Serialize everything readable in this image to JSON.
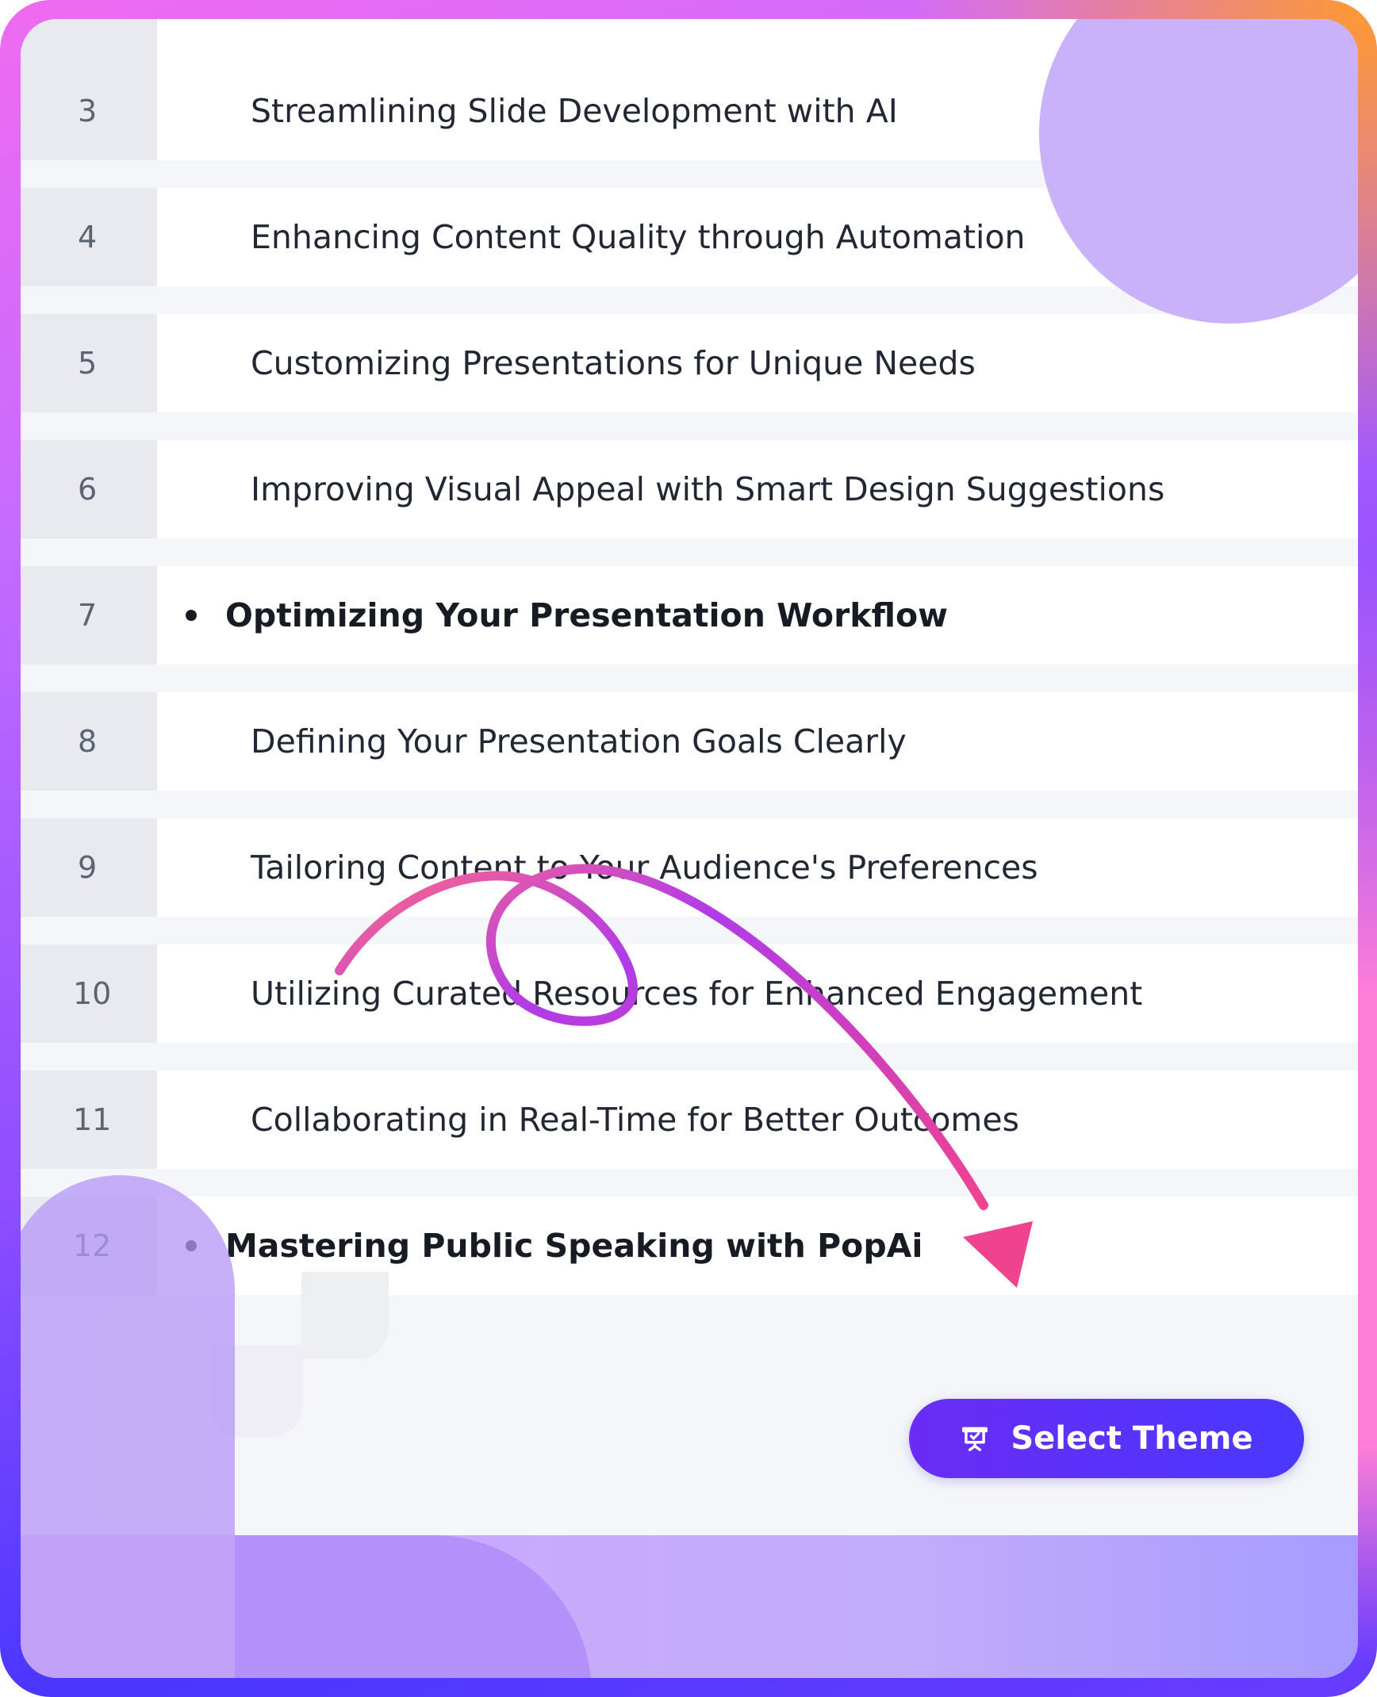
{
  "outline": {
    "rows": [
      {
        "num": "3",
        "title": "Streamlining Slide Development with AI",
        "kind": "sub"
      },
      {
        "num": "4",
        "title": "Enhancing Content Quality through Automation",
        "kind": "sub"
      },
      {
        "num": "5",
        "title": "Customizing Presentations for Unique Needs",
        "kind": "sub"
      },
      {
        "num": "6",
        "title": "Improving Visual Appeal with Smart Design Suggestions",
        "kind": "sub"
      },
      {
        "num": "7",
        "title": "Optimizing Your Presentation Workflow",
        "kind": "head"
      },
      {
        "num": "8",
        "title": "Defining Your Presentation Goals Clearly",
        "kind": "sub"
      },
      {
        "num": "9",
        "title": "Tailoring Content to Your Audience's Preferences",
        "kind": "sub"
      },
      {
        "num": "10",
        "title": "Utilizing Curated Resources for Enhanced Engagement",
        "kind": "sub"
      },
      {
        "num": "11",
        "title": "Collaborating in Real-Time for Better Outcomes",
        "kind": "sub"
      },
      {
        "num": "12",
        "title": "Mastering Public Speaking with PopAi",
        "kind": "head"
      }
    ]
  },
  "actions": {
    "select_theme_label": "Select Theme",
    "select_theme_icon": "presentation-icon"
  },
  "colors": {
    "accent_button": "#5a33f8",
    "row_number_bg": "#e8eaef",
    "arrow_start": "#ff6a86",
    "arrow_mid": "#b13be8",
    "arrow_end": "#f0438f"
  }
}
